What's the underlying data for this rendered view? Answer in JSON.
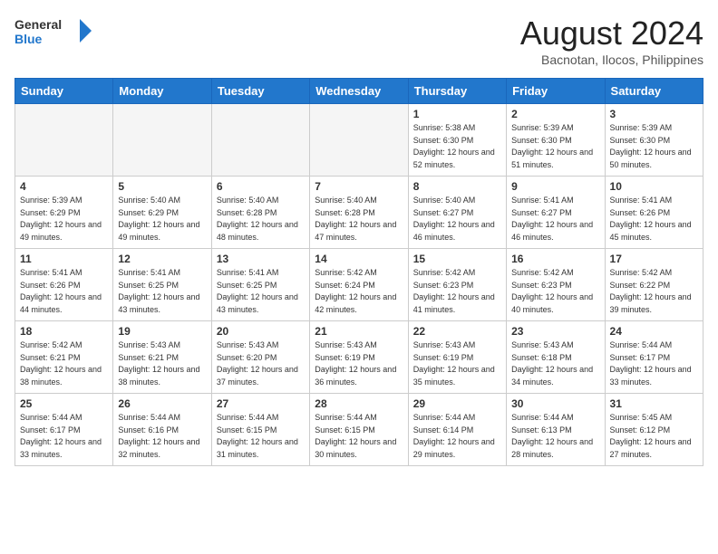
{
  "header": {
    "logo_general": "General",
    "logo_blue": "Blue",
    "month_year": "August 2024",
    "location": "Bacnotan, Ilocos, Philippines"
  },
  "weekdays": [
    "Sunday",
    "Monday",
    "Tuesday",
    "Wednesday",
    "Thursday",
    "Friday",
    "Saturday"
  ],
  "weeks": [
    [
      {
        "day": "",
        "empty": true
      },
      {
        "day": "",
        "empty": true
      },
      {
        "day": "",
        "empty": true
      },
      {
        "day": "",
        "empty": true
      },
      {
        "day": "1",
        "sunrise": "5:38 AM",
        "sunset": "6:30 PM",
        "daylight": "12 hours and 52 minutes."
      },
      {
        "day": "2",
        "sunrise": "5:39 AM",
        "sunset": "6:30 PM",
        "daylight": "12 hours and 51 minutes."
      },
      {
        "day": "3",
        "sunrise": "5:39 AM",
        "sunset": "6:30 PM",
        "daylight": "12 hours and 50 minutes."
      }
    ],
    [
      {
        "day": "4",
        "sunrise": "5:39 AM",
        "sunset": "6:29 PM",
        "daylight": "12 hours and 49 minutes."
      },
      {
        "day": "5",
        "sunrise": "5:40 AM",
        "sunset": "6:29 PM",
        "daylight": "12 hours and 49 minutes."
      },
      {
        "day": "6",
        "sunrise": "5:40 AM",
        "sunset": "6:28 PM",
        "daylight": "12 hours and 48 minutes."
      },
      {
        "day": "7",
        "sunrise": "5:40 AM",
        "sunset": "6:28 PM",
        "daylight": "12 hours and 47 minutes."
      },
      {
        "day": "8",
        "sunrise": "5:40 AM",
        "sunset": "6:27 PM",
        "daylight": "12 hours and 46 minutes."
      },
      {
        "day": "9",
        "sunrise": "5:41 AM",
        "sunset": "6:27 PM",
        "daylight": "12 hours and 46 minutes."
      },
      {
        "day": "10",
        "sunrise": "5:41 AM",
        "sunset": "6:26 PM",
        "daylight": "12 hours and 45 minutes."
      }
    ],
    [
      {
        "day": "11",
        "sunrise": "5:41 AM",
        "sunset": "6:26 PM",
        "daylight": "12 hours and 44 minutes."
      },
      {
        "day": "12",
        "sunrise": "5:41 AM",
        "sunset": "6:25 PM",
        "daylight": "12 hours and 43 minutes."
      },
      {
        "day": "13",
        "sunrise": "5:41 AM",
        "sunset": "6:25 PM",
        "daylight": "12 hours and 43 minutes."
      },
      {
        "day": "14",
        "sunrise": "5:42 AM",
        "sunset": "6:24 PM",
        "daylight": "12 hours and 42 minutes."
      },
      {
        "day": "15",
        "sunrise": "5:42 AM",
        "sunset": "6:23 PM",
        "daylight": "12 hours and 41 minutes."
      },
      {
        "day": "16",
        "sunrise": "5:42 AM",
        "sunset": "6:23 PM",
        "daylight": "12 hours and 40 minutes."
      },
      {
        "day": "17",
        "sunrise": "5:42 AM",
        "sunset": "6:22 PM",
        "daylight": "12 hours and 39 minutes."
      }
    ],
    [
      {
        "day": "18",
        "sunrise": "5:42 AM",
        "sunset": "6:21 PM",
        "daylight": "12 hours and 38 minutes."
      },
      {
        "day": "19",
        "sunrise": "5:43 AM",
        "sunset": "6:21 PM",
        "daylight": "12 hours and 38 minutes."
      },
      {
        "day": "20",
        "sunrise": "5:43 AM",
        "sunset": "6:20 PM",
        "daylight": "12 hours and 37 minutes."
      },
      {
        "day": "21",
        "sunrise": "5:43 AM",
        "sunset": "6:19 PM",
        "daylight": "12 hours and 36 minutes."
      },
      {
        "day": "22",
        "sunrise": "5:43 AM",
        "sunset": "6:19 PM",
        "daylight": "12 hours and 35 minutes."
      },
      {
        "day": "23",
        "sunrise": "5:43 AM",
        "sunset": "6:18 PM",
        "daylight": "12 hours and 34 minutes."
      },
      {
        "day": "24",
        "sunrise": "5:44 AM",
        "sunset": "6:17 PM",
        "daylight": "12 hours and 33 minutes."
      }
    ],
    [
      {
        "day": "25",
        "sunrise": "5:44 AM",
        "sunset": "6:17 PM",
        "daylight": "12 hours and 33 minutes."
      },
      {
        "day": "26",
        "sunrise": "5:44 AM",
        "sunset": "6:16 PM",
        "daylight": "12 hours and 32 minutes."
      },
      {
        "day": "27",
        "sunrise": "5:44 AM",
        "sunset": "6:15 PM",
        "daylight": "12 hours and 31 minutes."
      },
      {
        "day": "28",
        "sunrise": "5:44 AM",
        "sunset": "6:15 PM",
        "daylight": "12 hours and 30 minutes."
      },
      {
        "day": "29",
        "sunrise": "5:44 AM",
        "sunset": "6:14 PM",
        "daylight": "12 hours and 29 minutes."
      },
      {
        "day": "30",
        "sunrise": "5:44 AM",
        "sunset": "6:13 PM",
        "daylight": "12 hours and 28 minutes."
      },
      {
        "day": "31",
        "sunrise": "5:45 AM",
        "sunset": "6:12 PM",
        "daylight": "12 hours and 27 minutes."
      }
    ]
  ]
}
